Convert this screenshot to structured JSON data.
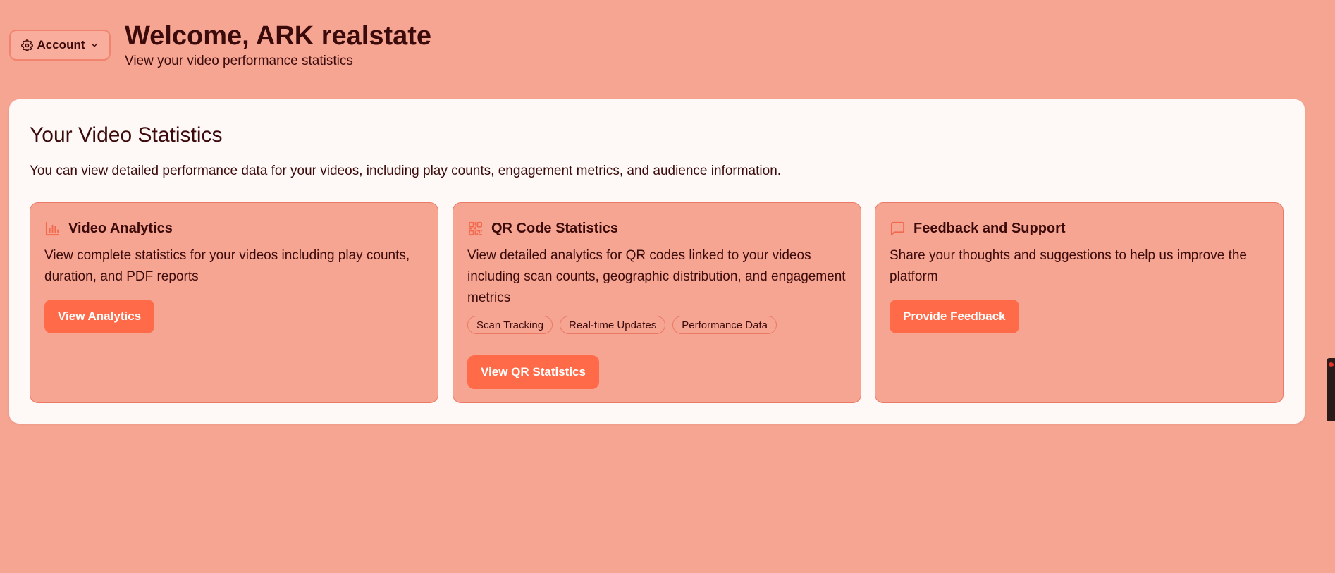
{
  "header": {
    "account_label": "Account",
    "welcome_title": "Welcome, ARK realstate",
    "welcome_subtitle": "View your video performance statistics"
  },
  "panel": {
    "title": "Your Video Statistics",
    "description": "You can view detailed performance data for your videos, including play counts, engagement metrics, and audience information."
  },
  "cards": [
    {
      "icon": "bar-chart-icon",
      "title": "Video Analytics",
      "body": "View complete statistics for your videos including play counts, duration, and PDF reports",
      "button": "View Analytics"
    },
    {
      "icon": "qr-code-icon",
      "title": "QR Code Statistics",
      "body": "View detailed analytics for QR codes linked to your videos including scan counts, geographic distribution, and engagement metrics",
      "tags": [
        "Scan Tracking",
        "Real-time Updates",
        "Performance Data"
      ],
      "button": "View QR Statistics"
    },
    {
      "icon": "message-square-icon",
      "title": "Feedback and Support",
      "body": "Share your thoughts and suggestions to help us improve the platform",
      "button": "Provide Feedback"
    }
  ],
  "colors": {
    "background": "#f7a593",
    "panel": "#fef8f6",
    "accent": "#ff6a48",
    "text": "#3b0a0a",
    "icon": "#f26a4e"
  }
}
